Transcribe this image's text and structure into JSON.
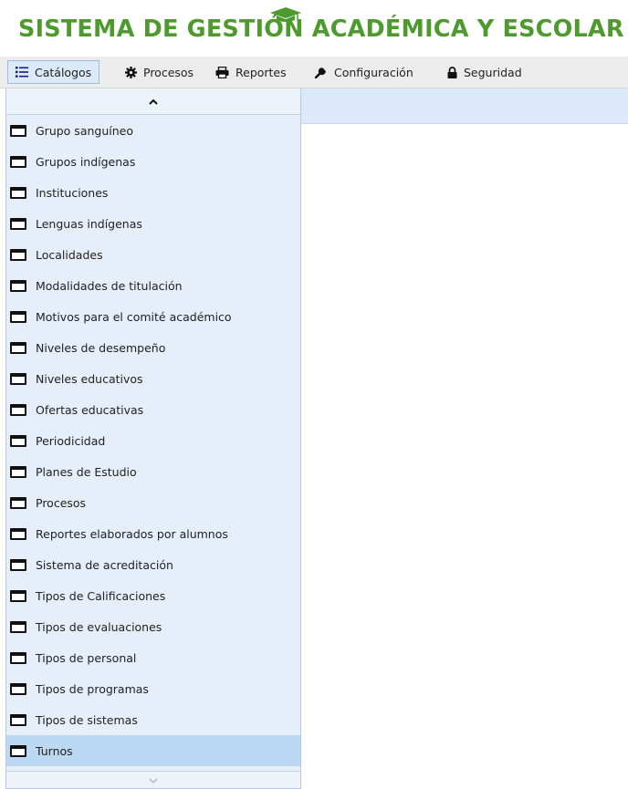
{
  "header": {
    "title": "SISTEMA DE GESTIÓN ACADÉMICA Y ESCOLAR"
  },
  "colors": {
    "brand_green": "#4e9a2e",
    "menu_active_bg": "#dbe9f8",
    "dropdown_bg": "#e6eefa",
    "selected_item_bg": "#bcd8f2"
  },
  "menubar": {
    "items": [
      {
        "label": "Catálogos",
        "icon": "list-icon"
      },
      {
        "label": "Procesos",
        "icon": "gear-icon"
      },
      {
        "label": "Reportes",
        "icon": "printer-icon"
      },
      {
        "label": "Configuración",
        "icon": "wrench-icon"
      },
      {
        "label": "Seguridad",
        "icon": "lock-icon"
      }
    ],
    "active_index": 0
  },
  "dropdown": {
    "items": [
      "Grupo sanguíneo",
      "Grupos indígenas",
      "Instituciones",
      "Lenguas indígenas",
      "Localidades",
      "Modalidades de titulación",
      "Motivos para el comité académico",
      "Niveles de desempeño",
      "Niveles educativos",
      "Ofertas educativas",
      "Periodicidad",
      "Planes de Estudio",
      "Procesos",
      "Reportes elaborados por alumnos",
      "Sistema de acreditación",
      "Tipos de Calificaciones",
      "Tipos de evaluaciones",
      "Tipos de personal",
      "Tipos de programas",
      "Tipos de sistemas",
      "Turnos"
    ],
    "selected_index": 20,
    "item_icon": "window-icon"
  }
}
